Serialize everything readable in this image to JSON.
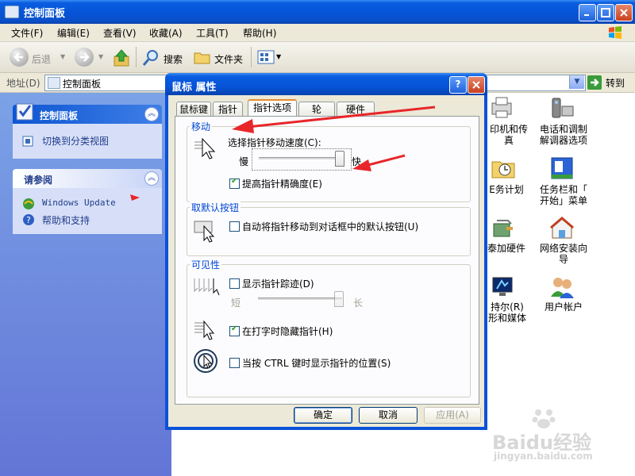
{
  "window": {
    "title": "控制面板"
  },
  "menu": [
    "文件(F)",
    "编辑(E)",
    "查看(V)",
    "收藏(A)",
    "工具(T)",
    "帮助(H)"
  ],
  "toolbar": {
    "back_label": "后退",
    "search_label": "搜索",
    "folders_label": "文件夹"
  },
  "address": {
    "label": "地址(D)",
    "value": "控制面板",
    "go_label": "转到"
  },
  "taskpane": {
    "panel1": {
      "title": "控制面板",
      "link": "切换到分类视图"
    },
    "panel2": {
      "title": "请参阅",
      "links": [
        "Windows Update",
        "帮助和支持"
      ]
    }
  },
  "icons": [
    {
      "label": "印机和传\n真",
      "icon": "printer-fax-icon"
    },
    {
      "label": "电话和调制\n解调器选项",
      "icon": "phone-modem-icon"
    },
    {
      "label": "E务计划",
      "icon": "scheduled-tasks-icon"
    },
    {
      "label": "任务栏和「\n开始」菜单",
      "icon": "taskbar-start-icon"
    },
    {
      "label": "泰加硬件",
      "icon": "add-hardware-icon"
    },
    {
      "label": "网络安装向\n导",
      "icon": "network-setup-icon"
    },
    {
      "label": "持尔(R)\n形和媒体",
      "icon": "sound-media-icon"
    },
    {
      "label": "用户帐户",
      "icon": "user-accounts-icon"
    }
  ],
  "dialog": {
    "title": "鼠标 属性",
    "tabs": [
      "鼠标键",
      "指针",
      "指针选项",
      "轮",
      "硬件"
    ],
    "active_tab": "指针选项",
    "motion": {
      "title": "移动",
      "speed_label": "选择指针移动速度(C):",
      "slow": "慢",
      "fast": "快",
      "speed_level": 0.95,
      "precision_label": "提高指针精确度(E)",
      "precision_checked": true
    },
    "snap": {
      "title": "取默认按钮",
      "label": "自动将指针移动到对话框中的默认按钮(U)",
      "checked": false
    },
    "visibility": {
      "title": "可见性",
      "trails_label": "显示指针踪迹(D)",
      "trails_checked": false,
      "short": "短",
      "long": "长",
      "trail_level": 0.95,
      "hide_label": "在打字时隐藏指针(H)",
      "hide_checked": true,
      "ctrl_label": "当按 CTRL 键时显示指针的位置(S)",
      "ctrl_checked": false
    },
    "buttons": {
      "ok": "确定",
      "cancel": "取消",
      "apply": "应用(A)"
    }
  },
  "watermark": {
    "brand": "Baidu经验",
    "url": "jingyan.baidu.com"
  },
  "colors": {
    "xp_blue": "#0a5de0",
    "annotation_red": "#e8262a",
    "group_title": "#0046d5"
  }
}
